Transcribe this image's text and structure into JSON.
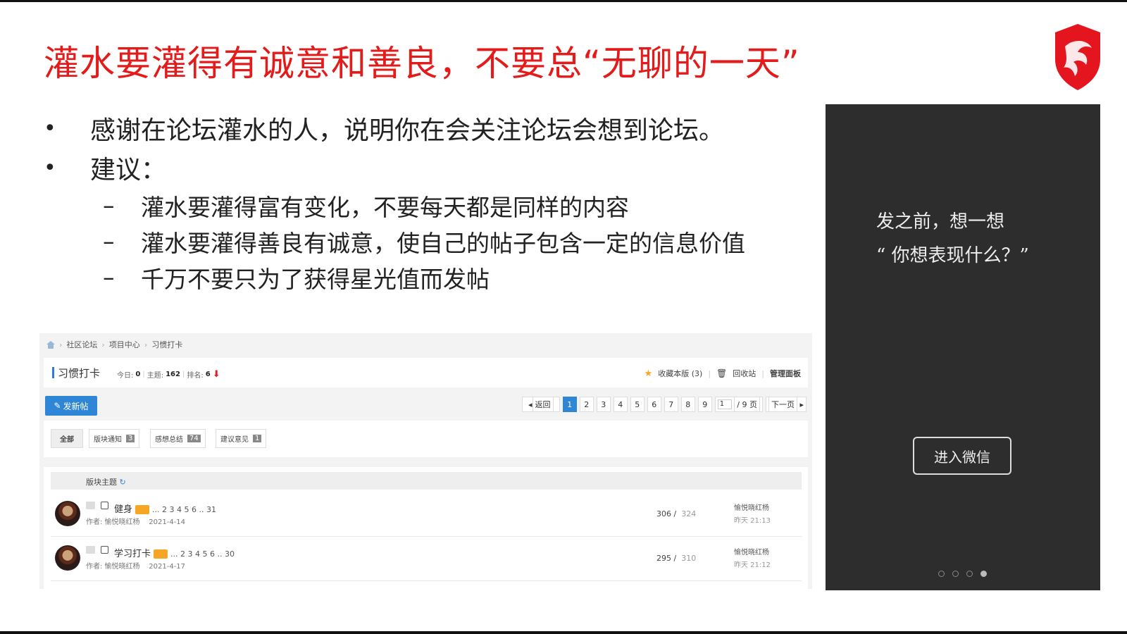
{
  "slide": {
    "title": "灌水要灌得有诚意和善良，不要总“无聊的一天”",
    "bullets": [
      "感谢在论坛灌水的人，说明你在会关注论坛会想到论坛。",
      "建议："
    ],
    "sub_bullets": [
      "灌水要灌得富有变化，不要每天都是同样的内容",
      "灌水要灌得善良有诚意，使自己的帖子包含一定的信息价值",
      "千万不要只为了获得星光值而发帖"
    ],
    "bullet_symbol": "•",
    "dash_symbol": "–"
  },
  "forum": {
    "breadcrumbs": [
      "社区论坛",
      "项目中心",
      "习惯打卡"
    ],
    "section_name": "习惯打卡",
    "stats": {
      "today_label": "今日:",
      "today": "0",
      "topics_label": "主题:",
      "topics": "162",
      "rank_label": "排名:",
      "rank": "6"
    },
    "right_links": {
      "favorite": "收藏本版 (3)",
      "recycle": "回收站",
      "admin": "管理面板"
    },
    "new_post": "发新帖",
    "pager": {
      "back": "返回",
      "pages": [
        "1",
        "2",
        "3",
        "4",
        "5",
        "6",
        "7",
        "8",
        "9"
      ],
      "current": "1",
      "input_value": "1",
      "total": "/ 9 页",
      "next": "下一页"
    },
    "filters": [
      {
        "label": "全部",
        "count": ""
      },
      {
        "label": "版块通知",
        "count": "3"
      },
      {
        "label": "感想总结",
        "count": "74"
      },
      {
        "label": "建议意见",
        "count": "1"
      }
    ],
    "thread_header": "版块主题",
    "threads": [
      {
        "title": "健身",
        "pages": "... 2  3  4  5  6 .. 31",
        "author": "作者: 愉悦晓红杨",
        "date": "2021-4-14",
        "replies": "306",
        "views": "324",
        "last_user": "愉悦晓红杨",
        "last_time": "昨天 21:13"
      },
      {
        "title": "学习打卡",
        "pages": "... 2  3  4  5  6 .. 30",
        "author": "作者: 愉悦晓红杨",
        "date": "2021-4-17",
        "replies": "295",
        "views": "310",
        "last_user": "愉悦晓红杨",
        "last_time": "昨天 21:12"
      }
    ]
  },
  "phone": {
    "line1": "发之前，想一想",
    "line2": "“ 你想表现什么？”",
    "button": "进入微信"
  },
  "colors": {
    "title_red": "#e31b1b",
    "link_blue": "#2f86d6",
    "phone_bg": "#2d2d2d"
  }
}
